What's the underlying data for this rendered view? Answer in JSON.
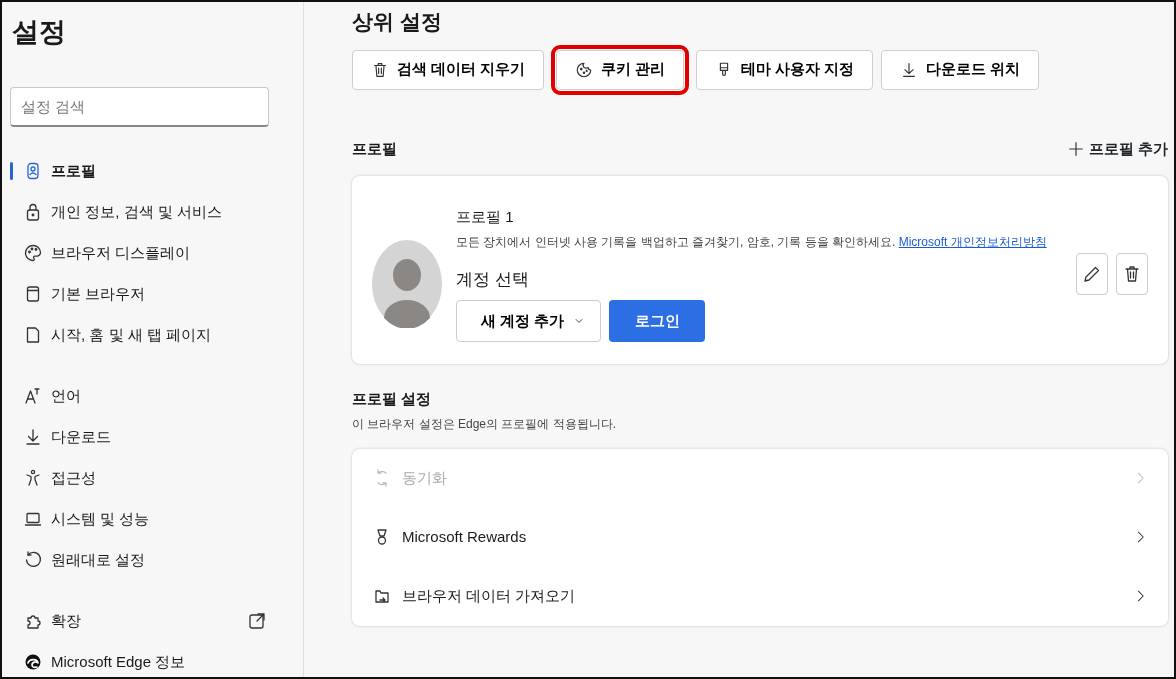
{
  "sidebar": {
    "title": "설정",
    "search": {
      "placeholder": "설정 검색"
    },
    "groups": [
      {
        "items": [
          {
            "label": "프로필",
            "selected": true,
            "external": false
          },
          {
            "label": "개인 정보, 검색 및 서비스",
            "selected": false,
            "external": false
          },
          {
            "label": "브라우저 디스플레이",
            "selected": false,
            "external": false
          },
          {
            "label": "기본 브라우저",
            "selected": false,
            "external": false
          },
          {
            "label": "시작, 홈 및 새 탭 페이지",
            "selected": false,
            "external": false
          }
        ]
      },
      {
        "items": [
          {
            "label": "언어",
            "selected": false,
            "external": false
          },
          {
            "label": "다운로드",
            "selected": false,
            "external": false
          },
          {
            "label": "접근성",
            "selected": false,
            "external": false
          },
          {
            "label": "시스템 및 성능",
            "selected": false,
            "external": false
          },
          {
            "label": "원래대로 설정",
            "selected": false,
            "external": false
          }
        ]
      },
      {
        "items": [
          {
            "label": "확장",
            "selected": false,
            "external": true
          },
          {
            "label": "Microsoft Edge 정보",
            "selected": false,
            "external": false
          }
        ]
      }
    ]
  },
  "main": {
    "title": "상위 설정",
    "quick_actions": [
      {
        "label": "검색 데이터 지우기",
        "highlighted": false
      },
      {
        "label": "쿠키 관리",
        "highlighted": true
      },
      {
        "label": "테마 사용자 지정",
        "highlighted": false
      },
      {
        "label": "다운로드 위치",
        "highlighted": false
      }
    ],
    "profiles_heading": "프로필",
    "add_profile": "프로필 추가",
    "profile_card": {
      "name": "프로필 1",
      "description": "모든 장치에서 인터넷 사용 기록을 백업하고 즐겨찾기, 암호, 기록 등을 확인하세요.",
      "link": "Microsoft 개인정보처리방침",
      "account_label": "계정 선택",
      "account_dropdown": "새 계정 추가",
      "login_button": "로그인"
    },
    "profile_settings": {
      "heading": "프로필 설정",
      "subtitle": "이 브라우저 설정은 Edge의 프로필에 적용됩니다.",
      "rows": [
        {
          "label": "동기화",
          "disabled": true
        },
        {
          "label": "Microsoft Rewards",
          "disabled": false
        },
        {
          "label": "브라우저 데이터 가져오기",
          "disabled": false
        }
      ]
    }
  }
}
